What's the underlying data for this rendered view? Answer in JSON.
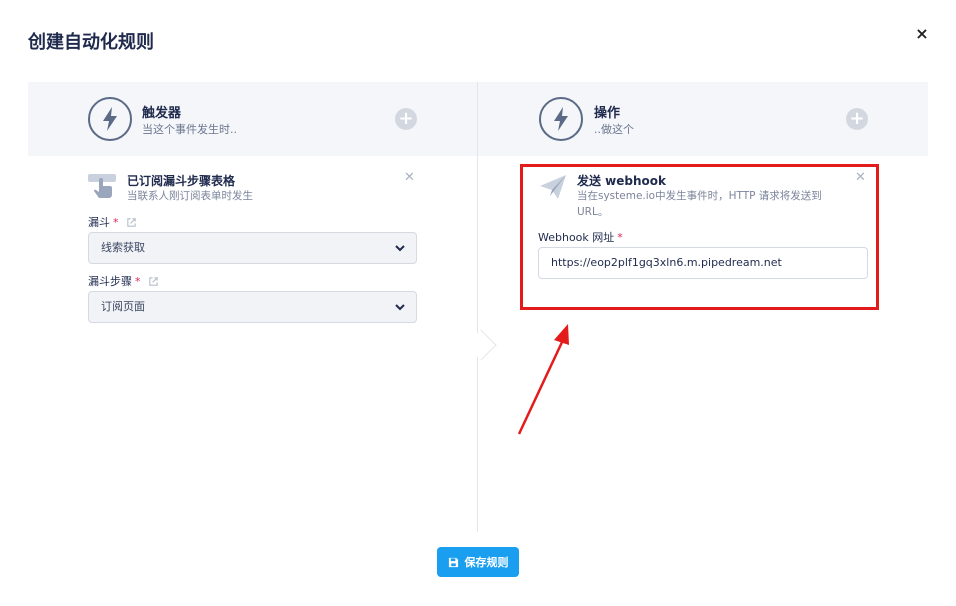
{
  "modal": {
    "title": "创建自动化规则",
    "close_label": "×"
  },
  "trigger": {
    "title": "触发器",
    "subtitle": "当这个事件发生时..",
    "card": {
      "title": "已订阅漏斗步骤表格",
      "subtitle": "当联系人刚订阅表单时发生",
      "fields": [
        {
          "label": "漏斗",
          "required_mark": "*",
          "value": "线索获取"
        },
        {
          "label": "漏斗步骤",
          "required_mark": "*",
          "value": "订阅页面"
        }
      ]
    }
  },
  "action": {
    "title": "操作",
    "subtitle": "..做这个",
    "card": {
      "title": "发送 webhook",
      "subtitle_line1": "当在systeme.io中发生事件时，HTTP 请求将发送到",
      "subtitle_line2": "URL。",
      "field_label": "Webhook 网址",
      "required_mark": "*",
      "field_value": "https://eop2plf1gq3xln6.m.pipedream.net"
    }
  },
  "footer": {
    "save_label": "保存规则"
  },
  "colors": {
    "accent": "#1a9ff0",
    "highlight": "#e41b1b",
    "text_dark": "#1f2a4d"
  },
  "icons": [
    "lightning-icon",
    "plus-icon",
    "hand-pointer-icon",
    "paper-plane-icon",
    "close-icon",
    "external-link-icon",
    "chevron-down-icon",
    "save-icon"
  ]
}
